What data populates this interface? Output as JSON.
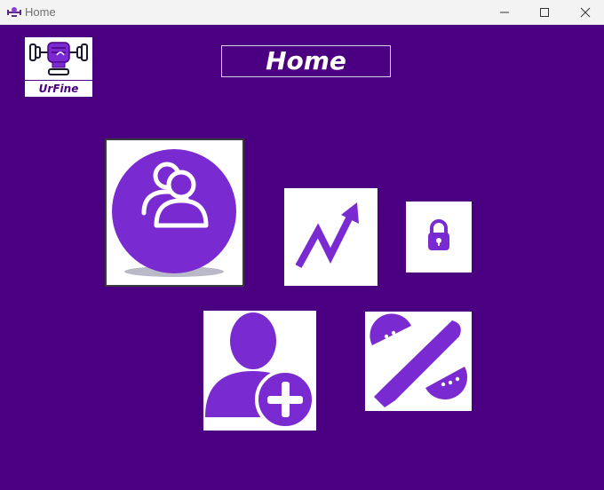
{
  "window": {
    "title": "Home",
    "minimize_icon": "minimize-icon",
    "maximize_icon": "maximize-icon",
    "close_icon": "close-icon"
  },
  "logo": {
    "label": "UrFine",
    "icon": "fist-dumbbell-icon"
  },
  "header": {
    "title": "Home"
  },
  "tiles": [
    {
      "name": "members",
      "icon": "users-icon"
    },
    {
      "name": "progress",
      "icon": "trending-up-icon"
    },
    {
      "name": "lock",
      "icon": "lock-icon"
    },
    {
      "name": "add-user",
      "icon": "add-user-icon"
    },
    {
      "name": "diet",
      "icon": "knife-fruit-icon"
    }
  ],
  "colors": {
    "background": "#4b0081",
    "accent": "#7a2ad1",
    "tile": "#ffffff"
  }
}
